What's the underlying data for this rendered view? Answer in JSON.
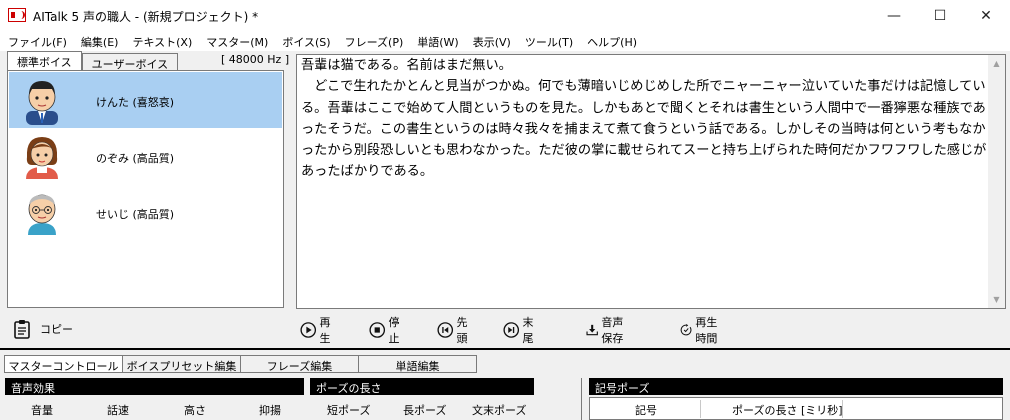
{
  "window": {
    "title": "AITalk 5 声の職人 - (新規プロジェクト) *",
    "min": "—",
    "max": "☐",
    "close": "✕"
  },
  "menu": [
    "ファイル(F)",
    "編集(E)",
    "テキスト(X)",
    "マスター(M)",
    "ボイス(S)",
    "フレーズ(P)",
    "単語(W)",
    "表示(V)",
    "ツール(T)",
    "ヘルプ(H)"
  ],
  "voice_tabs": {
    "standard": "標準ボイス",
    "user": "ユーザーボイス"
  },
  "sample_rate": "[ 48000 Hz ]",
  "voices": [
    {
      "name": "けんた (喜怒哀)",
      "icon": "male-avatar-icon"
    },
    {
      "name": "のぞみ (高品質)",
      "icon": "female-avatar-icon"
    },
    {
      "name": "せいじ (高品質)",
      "icon": "elderly-avatar-icon"
    }
  ],
  "copy_label": "コピー",
  "editor_text": "吾輩は猫である。名前はまだ無い。\n　どこで生れたかとんと見当がつかぬ。何でも薄暗いじめじめした所でニャーニャー泣いていた事だけは記憶している。吾輩はここで始めて人間というものを見た。しかもあとで聞くとそれは書生という人間中で一番獰悪な種族であったそうだ。この書生というのは時々我々を捕まえて煮て食うという話である。しかしその当時は何という考もなかったから別段恐しいとも思わなかった。ただ彼の掌に載せられてスーと持ち上げられた時何だかフワフワした感じがあったばかりである。",
  "toolbar": {
    "play": "再生",
    "stop": "停止",
    "first": "先頭",
    "last": "末尾",
    "save": "音声保存",
    "time": "再生時間"
  },
  "bottom_tabs": [
    "マスターコントロール",
    "ボイスプリセット編集",
    "フレーズ編集",
    "単語編集"
  ],
  "sections": {
    "effects": "音声効果",
    "pause": "ポーズの長さ",
    "symbol_pause": "記号ポーズ"
  },
  "params": {
    "volume": "音量",
    "speed": "話速",
    "pitch": "高さ",
    "intonation": "抑揚",
    "short_pause": "短ポーズ",
    "long_pause": "長ポーズ",
    "sentence_pause": "文末ポーズ"
  },
  "symbol_table": {
    "col_symbol": "記号",
    "col_length": "ポーズの長さ [ミリ秒]"
  }
}
